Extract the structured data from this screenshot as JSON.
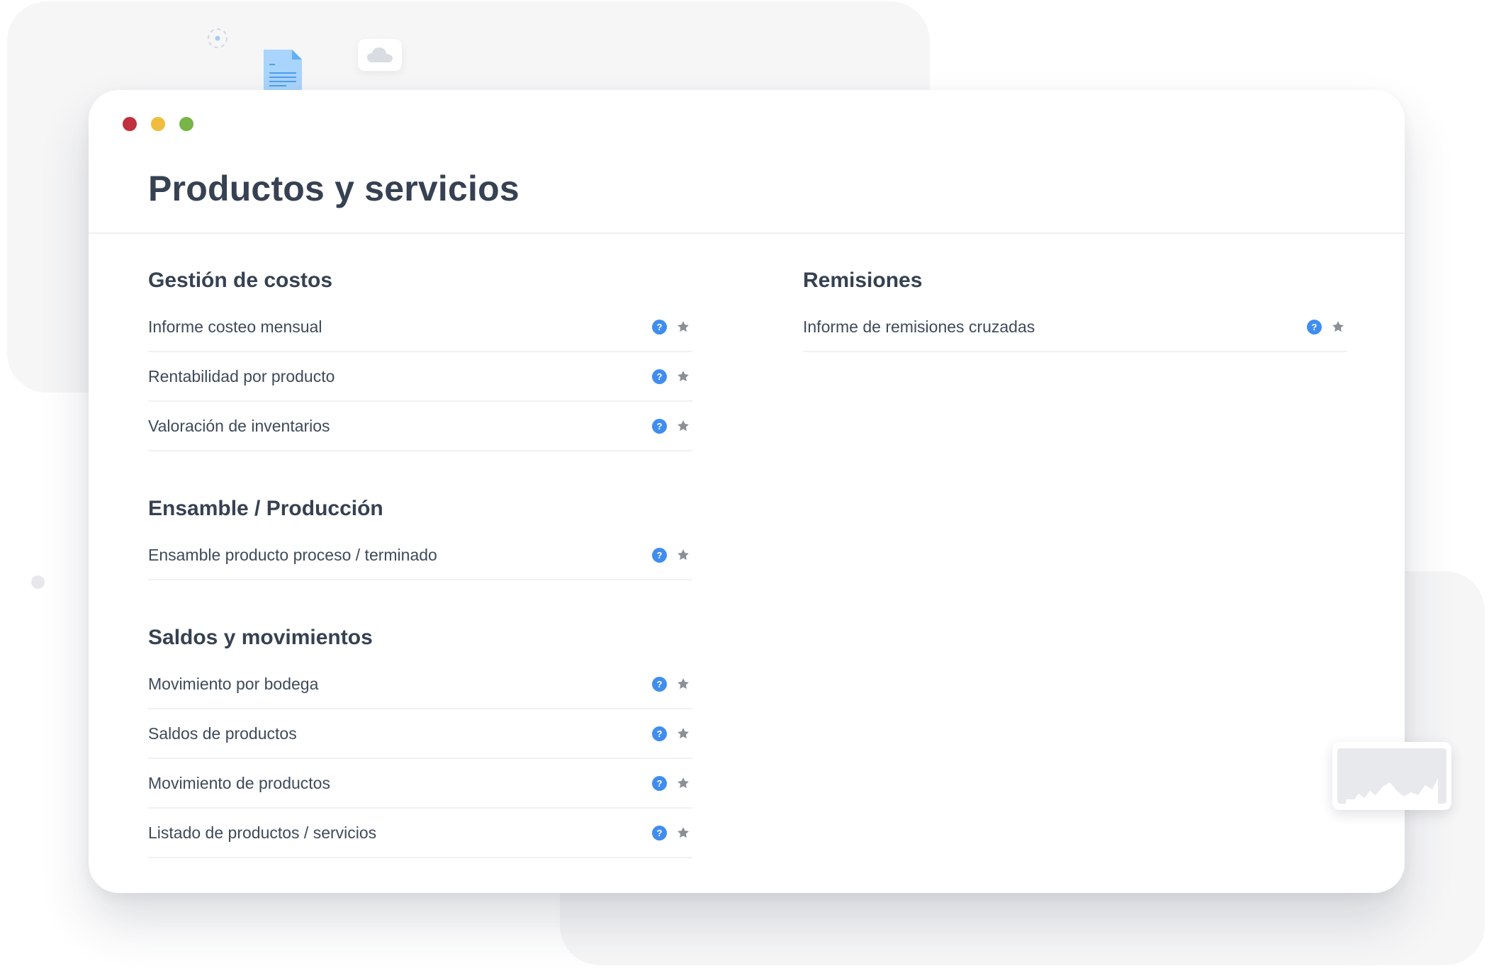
{
  "window": {
    "title": "Productos y servicios",
    "traffic_lights": [
      "#c0303e",
      "#efbc3d",
      "#76b546"
    ]
  },
  "left_column": {
    "groups": [
      {
        "title": "Gestión de costos",
        "items": [
          {
            "label": "Informe costeo mensual"
          },
          {
            "label": "Rentabilidad por producto"
          },
          {
            "label": "Valoración de inventarios"
          }
        ]
      },
      {
        "title": "Ensamble / Producción",
        "items": [
          {
            "label": "Ensamble producto proceso / terminado"
          }
        ]
      },
      {
        "title": "Saldos y movimientos",
        "items": [
          {
            "label": "Movimiento por bodega"
          },
          {
            "label": "Saldos de productos"
          },
          {
            "label": "Movimiento de productos"
          },
          {
            "label": "Listado de productos / servicios"
          }
        ]
      }
    ]
  },
  "right_column": {
    "groups": [
      {
        "title": "Remisiones",
        "items": [
          {
            "label": "Informe de remisiones cruzadas"
          }
        ]
      }
    ]
  },
  "icons": {
    "help": "help-icon",
    "help_glyph": "?",
    "favorite": "star-icon",
    "help_color": "#3f8def",
    "star_color": "#8b8f96"
  }
}
